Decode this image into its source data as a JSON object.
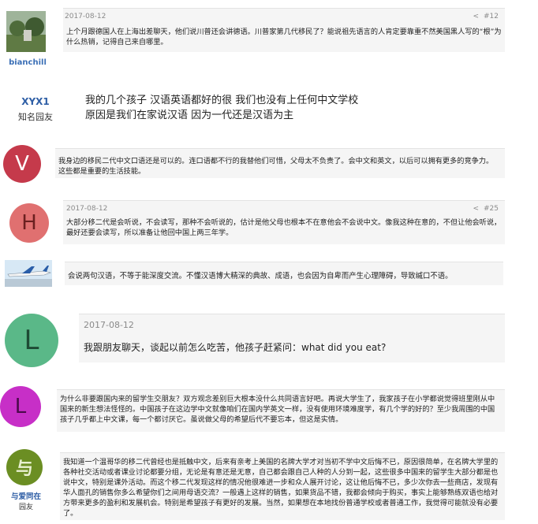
{
  "posts": [
    {
      "user": "bianchill",
      "date": "2017-08-12",
      "number": "#12",
      "text": "上个月跟德国人在上海出差聊天，他们说川普还会讲德语。川普家第几代移民了？能说祖先语言的人肯定要靠重不然美国黑人写的“根”为什么热销，记得自己来自哪里。"
    },
    {
      "user": "XYX1",
      "role": "知名园友",
      "lines": [
        "我的几个孩子 汉语英语都好的很 我们也没有上任何中文学校",
        "原因是我们在家说汉语 因为一代还是汉语为主"
      ]
    },
    {
      "avatar_letter": "V",
      "text": "我身边的移民二代中文口语还是可以的。连口语都不行的我替他们可惜，父母太不负责了。会中文和英文，以后可以拥有更多的竞争力。这些都是重要的生活技能。"
    },
    {
      "avatar_letter": "H",
      "date": "2017-08-12",
      "number": "#25",
      "text": "大部分移二代是会听说，不会读写，那种不会听说的，估计是他父母也根本不在意他会不会说中文。像我这种在意的，不但让他会听说，最好还要会读写，所以准备让他回中国上两三年学。"
    },
    {
      "text": "会说两句汉语，不等于能深度交流。不懂汉语博大精深的典故、成语，也会因为自卑而产生心理障碍，导致缄口不语。"
    },
    {
      "avatar_letter": "L",
      "date": "2017-08-12",
      "text": "我跟朋友聊天，谈起以前怎么吃苦，他孩子赶紧问：what did you eat?"
    },
    {
      "avatar_letter": "L",
      "text": "为什么非要跟国内来的留学生交朋友？双方观念差别巨大根本没什么共同语言好吧。再说大学生了，我家孩子在小学都说觉得班里刚从中国来的新生想法怪怪的。中国孩子在这边学中文就像咱们在国内学英文一样，没有使用环境难度学，有几个学的好的？至少我周围的中国孩子几乎都上中文课，每一个都讨厌它。虽说做父母的希望后代不要忘本，但这是实情。"
    },
    {
      "user": "与爱同在",
      "role": "园友",
      "avatar_glyph": "与",
      "text": "我知道一个温哥华的移二代曾经也是抵触中文，后来有亲考上美国的名牌大学才对当初不学中文后悔不已，原因很简单，在名牌大学里的各种社交活动或者课业讨论都要分组，无论是有意还是无意，自己都会跟自己人种的人分到一起，这些很多中国来的留学生大部分都是也说中文，特别是课外活动。而这个移二代发现这样的情况他很难进一步和众人展开讨论，这让他后悔不已，多少次你去一些商店，发现有华人面孔的销售你多么希望你们之间用母语交流？一般遇上这样的销售，如果货品不错，我都会倾向于购买，事实上能够熟练双语也给对方带来更多的盈利和发展机会。特别是希望孩子有更好的发展。当然，如果想在本地找份普通学校或者普通工作，我觉得可能就没有必要了。"
    }
  ],
  "colors": {
    "V": "#c53a4b",
    "H": "#e07070",
    "L1": "#5ab888",
    "L2": "#c72fc7",
    "yu": "#6b8e23"
  },
  "icons": {
    "share": "share-icon"
  }
}
